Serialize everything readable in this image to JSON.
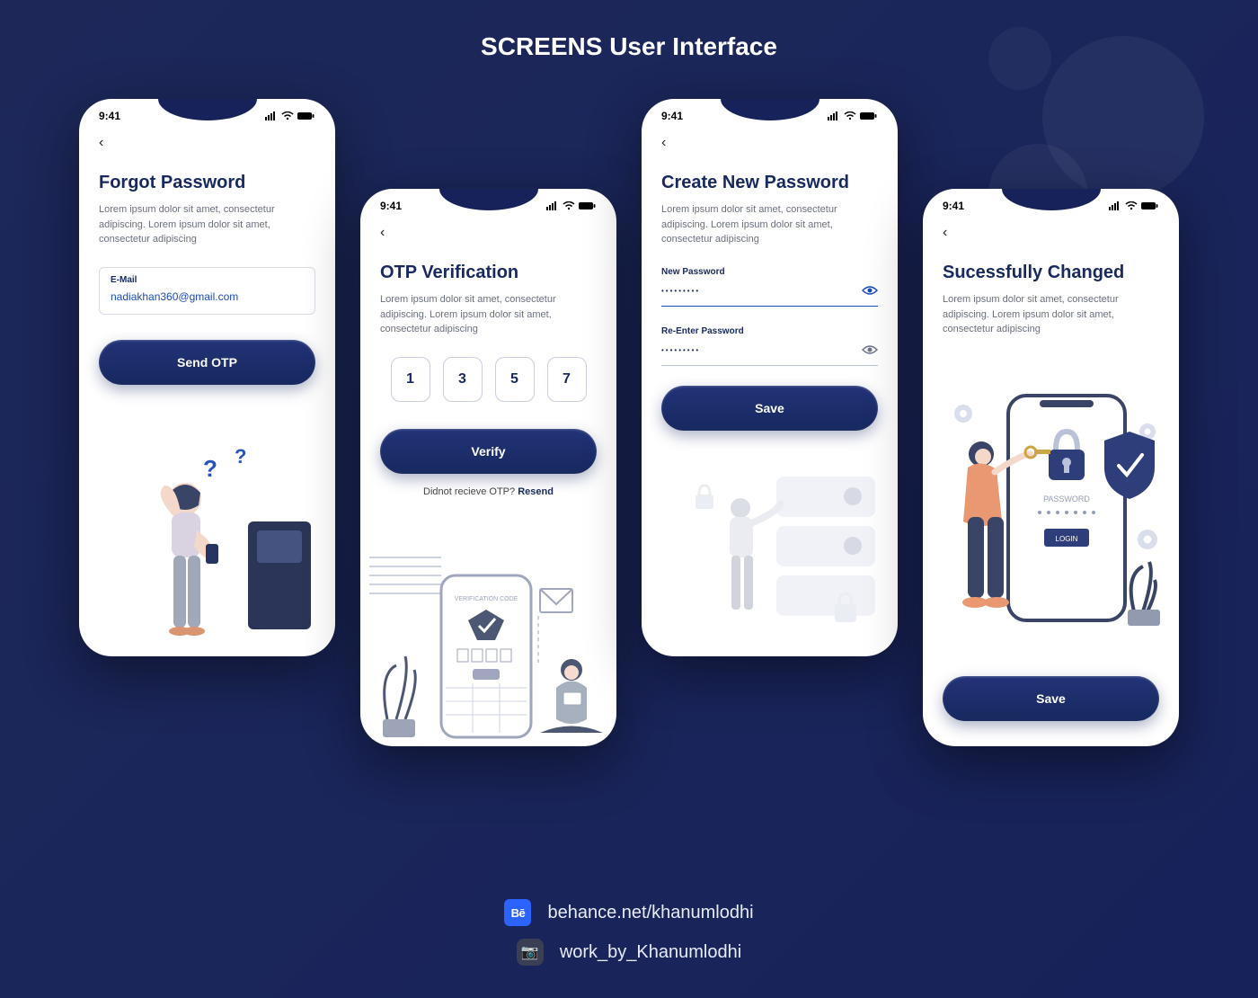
{
  "page": {
    "title": "SCREENS User Interface"
  },
  "status": {
    "time": "9:41"
  },
  "lorem": "Lorem ipsum dolor sit amet, consectetur adipiscing. Lorem ipsum dolor sit amet, consectetur adipiscing",
  "screens": {
    "forgot": {
      "title": "Forgot Password",
      "email_label": "E-Mail",
      "email_value": "nadiakhan360@gmail.com",
      "cta": "Send OTP"
    },
    "otp": {
      "title": "OTP Verification",
      "digits": [
        "1",
        "3",
        "5",
        "7"
      ],
      "cta": "Verify",
      "resend_prefix": "Didnot recieve OTP?",
      "resend_link": "Resend"
    },
    "create": {
      "title": "Create New Password",
      "new_label": "New Password",
      "re_label": "Re-Enter Password",
      "dots": "•••••••••",
      "cta": "Save"
    },
    "success": {
      "title": "Sucessfully Changed",
      "illus_password": "PASSWORD",
      "illus_login": "LOGIN",
      "cta": "Save"
    }
  },
  "footer": {
    "behance": "behance.net/khanumlodhi",
    "work": "work_by_Khanumlodhi"
  },
  "colors": {
    "brand": "#17295f",
    "accent": "#1b4bb8"
  }
}
